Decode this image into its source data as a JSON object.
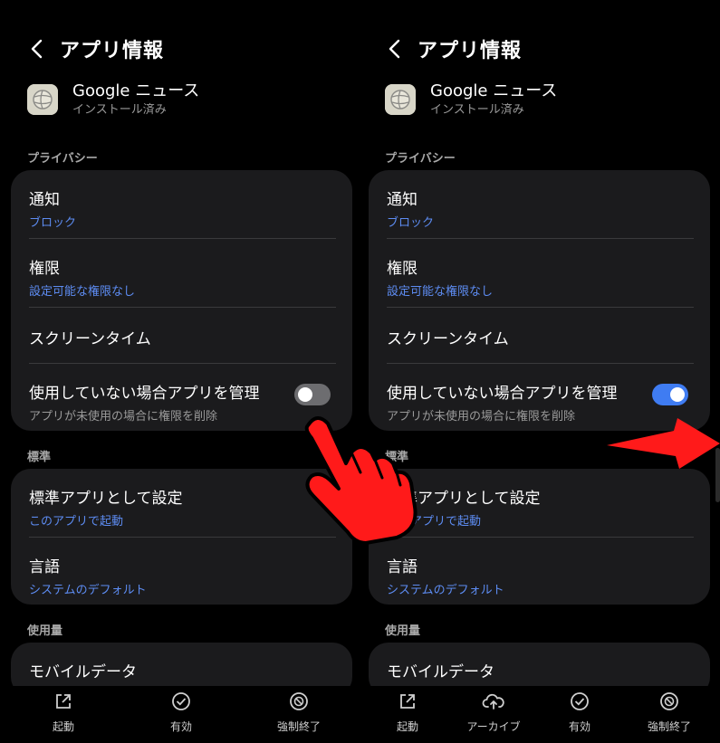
{
  "screens": [
    {
      "title": "アプリ情報",
      "app": {
        "name": "Google ニュース",
        "status": "インストール済み"
      },
      "sections": {
        "privacy": {
          "label": "プライバシー",
          "notifications": {
            "title": "通知",
            "value": "ブロック"
          },
          "permissions": {
            "title": "権限",
            "value": "設定可能な権限なし"
          },
          "screentime": {
            "title": "スクリーンタイム"
          },
          "unused": {
            "title": "使用していない場合アプリを管理",
            "desc": "アプリが未使用の場合に権限を削除",
            "toggle_on": false
          }
        },
        "default": {
          "label": "標準",
          "default_app": {
            "title": "標準アプリとして設定",
            "value": "このアプリで起動"
          },
          "language": {
            "title": "言語",
            "value": "システムのデフォルト"
          }
        },
        "usage": {
          "label": "使用量",
          "mobile_data": {
            "title": "モバイルデータ"
          }
        }
      },
      "bottom": {
        "open": "起動",
        "enable": "有効",
        "force_stop": "強制終了"
      }
    },
    {
      "title": "アプリ情報",
      "app": {
        "name": "Google ニュース",
        "status": "インストール済み"
      },
      "sections": {
        "privacy": {
          "label": "プライバシー",
          "notifications": {
            "title": "通知",
            "value": "ブロック"
          },
          "permissions": {
            "title": "権限",
            "value": "設定可能な権限なし"
          },
          "screentime": {
            "title": "スクリーンタイム"
          },
          "unused": {
            "title": "使用していない場合アプリを管理",
            "desc": "アプリが未使用の場合に権限を削除",
            "toggle_on": true
          }
        },
        "default": {
          "label": "標準",
          "default_app": {
            "title": "標準アプリとして設定",
            "value": "このアプリで起動"
          },
          "language": {
            "title": "言語",
            "value": "システムのデフォルト"
          }
        },
        "usage": {
          "label": "使用量",
          "mobile_data": {
            "title": "モバイルデータ"
          }
        }
      },
      "bottom": {
        "open": "起動",
        "archive": "アーカイブ",
        "enable": "有効",
        "force_stop": "強制終了"
      }
    }
  ],
  "colors": {
    "accent_blue": "#5d8cf2",
    "toggle_on": "#3f7cf2",
    "annotation_red": "#ff1a1a",
    "card_bg": "#1b1b1d"
  },
  "icons": [
    "back-arrow-icon",
    "google-news-app-icon",
    "open-external-icon",
    "archive-cloud-icon",
    "check-circle-icon",
    "block-circle-icon",
    "pointing-hand-icon",
    "red-arrow-icon"
  ]
}
